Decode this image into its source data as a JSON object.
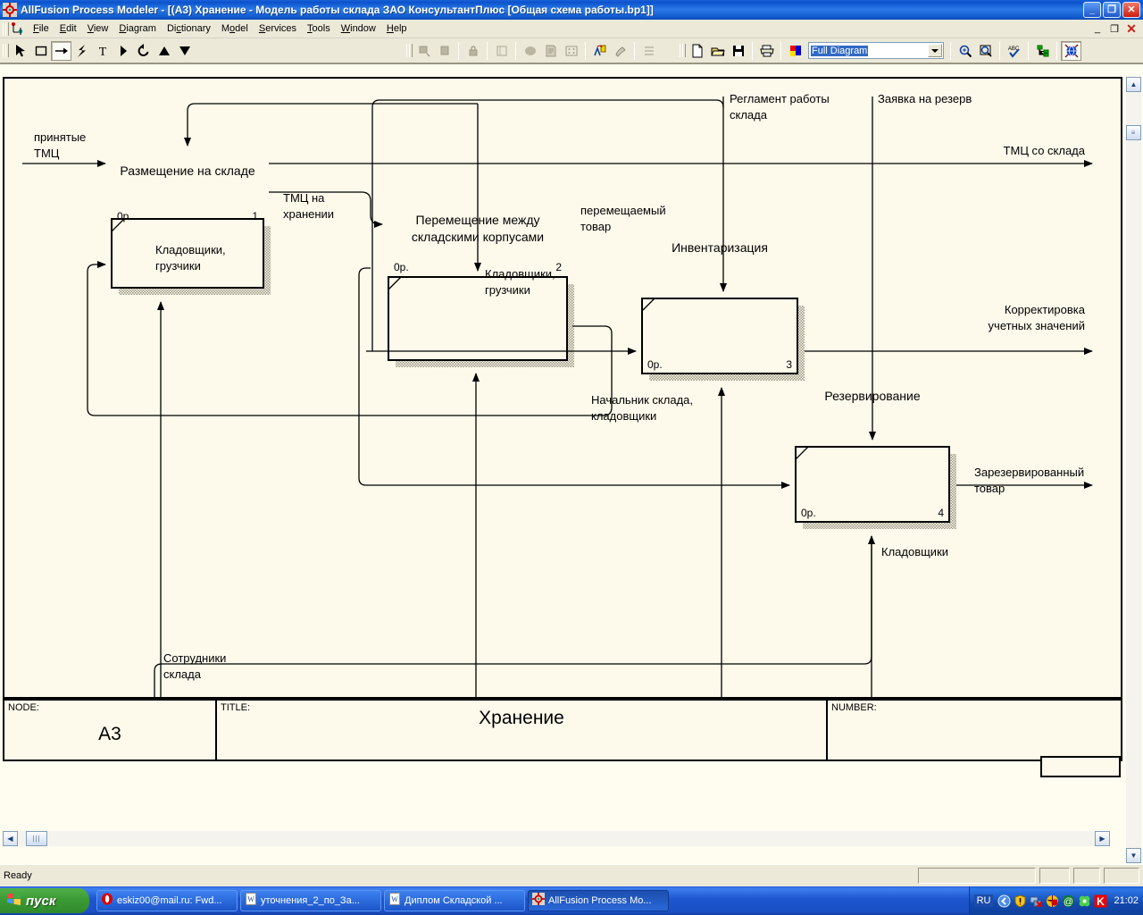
{
  "window": {
    "title": "AllFusion Process Modeler  - [(A3) Хранение  - Модель работы склада ЗАО КонсультантПлюс  [Общая схема работы.bp1]]",
    "icon": "target-crosshair-icon",
    "minimize_label": "_",
    "restore_label": "❐",
    "close_label": "✕"
  },
  "menu": {
    "items": [
      {
        "label": "File",
        "accel": "F"
      },
      {
        "label": "Edit",
        "accel": "E"
      },
      {
        "label": "View",
        "accel": "V"
      },
      {
        "label": "Diagram",
        "accel": "D"
      },
      {
        "label": "Dictionary",
        "accel": "c"
      },
      {
        "label": "Model",
        "accel": "o"
      },
      {
        "label": "Services",
        "accel": "S"
      },
      {
        "label": "Tools",
        "accel": "T"
      },
      {
        "label": "Window",
        "accel": "W"
      },
      {
        "label": "Help",
        "accel": "H"
      }
    ],
    "mdi_buttons": {
      "minimize": "_",
      "restore": "❐",
      "close": "✕"
    }
  },
  "toolbar": {
    "left_tools": [
      "pointer-arrow-icon",
      "rectangle-icon",
      "arrow-right-icon",
      "lightning-bolt-icon",
      "text-tool-icon",
      "play-triangle-icon",
      "rotate-ccw-icon",
      "triangle-up-icon",
      "triangle-down-icon"
    ],
    "disabled_tools": [
      "go-to-child-icon",
      "go-to-parent-icon",
      "lock-icon",
      "book-icon",
      "shape-icon",
      "report-icon",
      "grid-icon"
    ],
    "enabled_tools_2": [
      "font-color-icon",
      "paint-brush-icon"
    ],
    "disabled_tools_2": [
      "swimlane-icon"
    ],
    "file_tools": [
      "new-document-icon",
      "open-folder-icon",
      "save-disk-icon"
    ],
    "print_tools": [
      "print-icon"
    ],
    "color_tools": [
      "color-palette-icon"
    ],
    "zoom_combo": {
      "value": "Full Diagram",
      "options": [
        "Full Diagram"
      ]
    },
    "right_tools": [
      "zoom-in-icon",
      "zoom-region-icon",
      "spell-check-icon",
      "model-tree-icon",
      "globe-icon"
    ]
  },
  "diagram": {
    "activities": [
      {
        "id": 1,
        "name": "Размещение на складе",
        "cost": "0р.",
        "number": "1"
      },
      {
        "id": 2,
        "name": "Перемещение между\nскладскими корпусами",
        "cost": "0р.",
        "number": "2"
      },
      {
        "id": 3,
        "name": "Инвентаризация",
        "cost": "0р.",
        "number": "3"
      },
      {
        "id": 4,
        "name": "Резервирование",
        "cost": "0р.",
        "number": "4"
      }
    ],
    "arrow_labels": [
      {
        "text": "принятые\nТМЦ"
      },
      {
        "text": "Регламент работы\nсклада"
      },
      {
        "text": "Заявка на резерв"
      },
      {
        "text": "ТМЦ со склада"
      },
      {
        "text": "ТМЦ на\nхранении"
      },
      {
        "text": "перемещаемый\nтовар"
      },
      {
        "text": "Кладовщики,\nгрузчики"
      },
      {
        "text": "Кладовщики,\nгрузчики"
      },
      {
        "text": "Корректировка\nучетных значений"
      },
      {
        "text": "Начальник склада,\nкладовщики"
      },
      {
        "text": "Зарезервированный\nтовар"
      },
      {
        "text": "Кладовщики"
      },
      {
        "text": "Сотрудники\nсклада"
      }
    ],
    "title_block": {
      "node_caption": "NODE:",
      "node_value": "A3",
      "title_caption": "TITLE:",
      "title_value": "Хранение",
      "number_caption": "NUMBER:",
      "number_value": ""
    },
    "colors": {
      "canvas": "#fdfaec",
      "ink": "#000000",
      "shadow": "#b9b5a0"
    }
  },
  "status": {
    "text": "Ready"
  },
  "taskbar": {
    "start_label": "пуск",
    "start_icon": "windows-flag-icon",
    "tasks": [
      {
        "label": "eskiz00@mail.ru: Fwd...",
        "icon": "opera-o-icon",
        "active": false
      },
      {
        "label": "уточнения_2_по_За...",
        "icon": "word-doc-icon",
        "active": false
      },
      {
        "label": "Диплом Складской ...",
        "icon": "word-doc-icon",
        "active": false
      },
      {
        "label": "AllFusion Process Mo...",
        "icon": "target-crosshair-icon",
        "active": true
      }
    ],
    "tray": {
      "language": "RU",
      "icons": [
        "show-hidden-arrow-icon",
        "warning-shield-icon",
        "network-disconnected-icon",
        "antivirus-globe-icon",
        "at-sign-icon",
        "clover-icon",
        "kaspersky-k-icon"
      ],
      "clock": "21:02"
    }
  }
}
